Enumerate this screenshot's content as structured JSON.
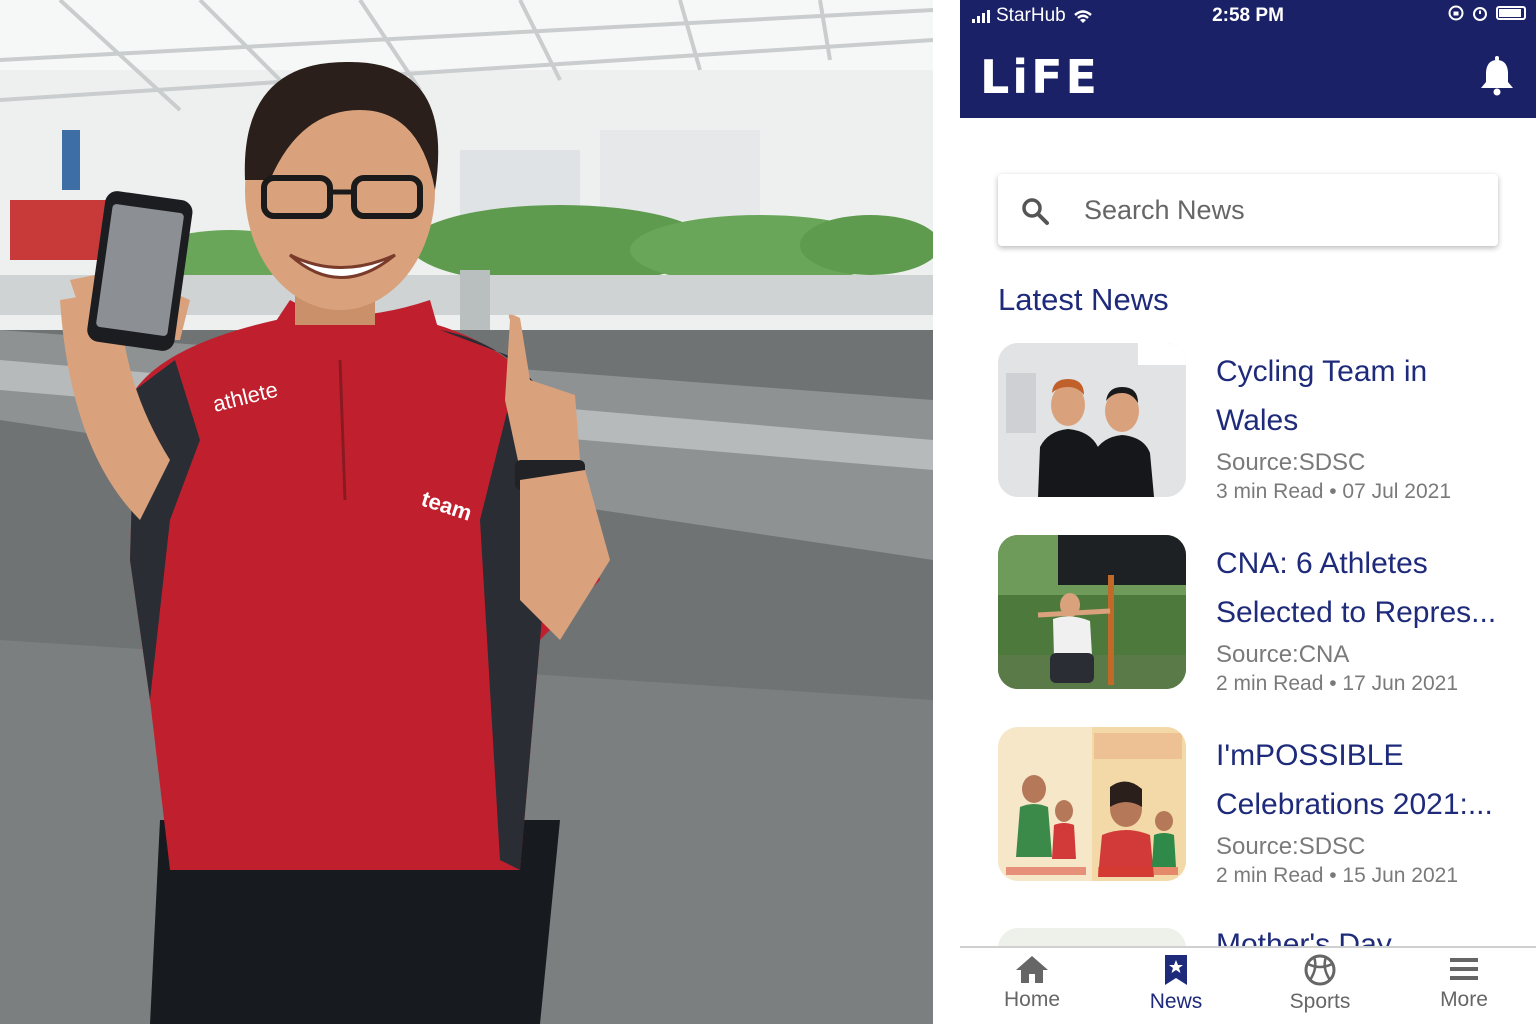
{
  "status_bar": {
    "carrier": "StarHub",
    "time": "2:58 PM"
  },
  "app_bar": {
    "logo": "LiFE",
    "bell_icon": "bell-icon"
  },
  "search": {
    "placeholder": "Search News",
    "icon": "search-icon"
  },
  "section": {
    "title": "Latest News"
  },
  "news": [
    {
      "title_line1": "Cycling Team in",
      "title_line2": "Wales",
      "source": "Source:SDSC",
      "meta": "3 min Read • 07 Jul 2021"
    },
    {
      "title_line1": "CNA: 6 Athletes",
      "title_line2": "Selected to Repres...",
      "source": "Source:CNA",
      "meta": "2 min Read • 17 Jun 2021"
    },
    {
      "title_line1": "I'mPOSSIBLE",
      "title_line2": "Celebrations 2021:...",
      "source": "Source:SDSC",
      "meta": "2 min Read • 15 Jun 2021"
    }
  ],
  "partial_news": {
    "title": "Mother's Day"
  },
  "tabs": [
    {
      "label": "Home",
      "icon": "home-icon"
    },
    {
      "label": "News",
      "icon": "bookmark-icon"
    },
    {
      "label": "Sports",
      "icon": "ball-icon"
    },
    {
      "label": "More",
      "icon": "menu-icon"
    }
  ],
  "photo": {
    "shirt_text": "athlete",
    "logo_text": "team"
  },
  "colors": {
    "primary": "#1b2167",
    "title_text": "#1e2a7a",
    "muted_text": "#7a7a7a",
    "shirt_red": "#c0202e"
  }
}
